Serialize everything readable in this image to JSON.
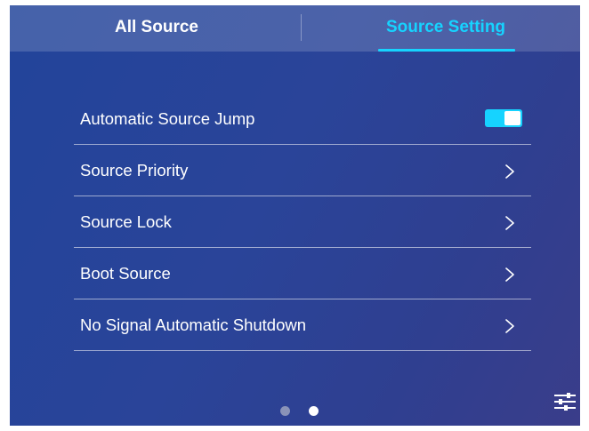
{
  "tabs": [
    {
      "label": "All Source",
      "active": false
    },
    {
      "label": "Source Setting",
      "active": true
    }
  ],
  "rows": [
    {
      "label": "Automatic Source Jump",
      "control": "toggle",
      "toggle_on": true
    },
    {
      "label": "Source Priority",
      "control": "chevron"
    },
    {
      "label": "Source Lock",
      "control": "chevron"
    },
    {
      "label": "Boot Source",
      "control": "chevron"
    },
    {
      "label": "No Signal Automatic Shutdown",
      "control": "chevron"
    }
  ],
  "pagination": {
    "page_count": 2,
    "current_page": 2
  },
  "icons": {
    "chevron": "chevron-right-icon",
    "settings": "sliders-icon"
  },
  "colors": {
    "accent": "#16d3ff",
    "background": "#2a4499",
    "text": "#ffffff"
  }
}
